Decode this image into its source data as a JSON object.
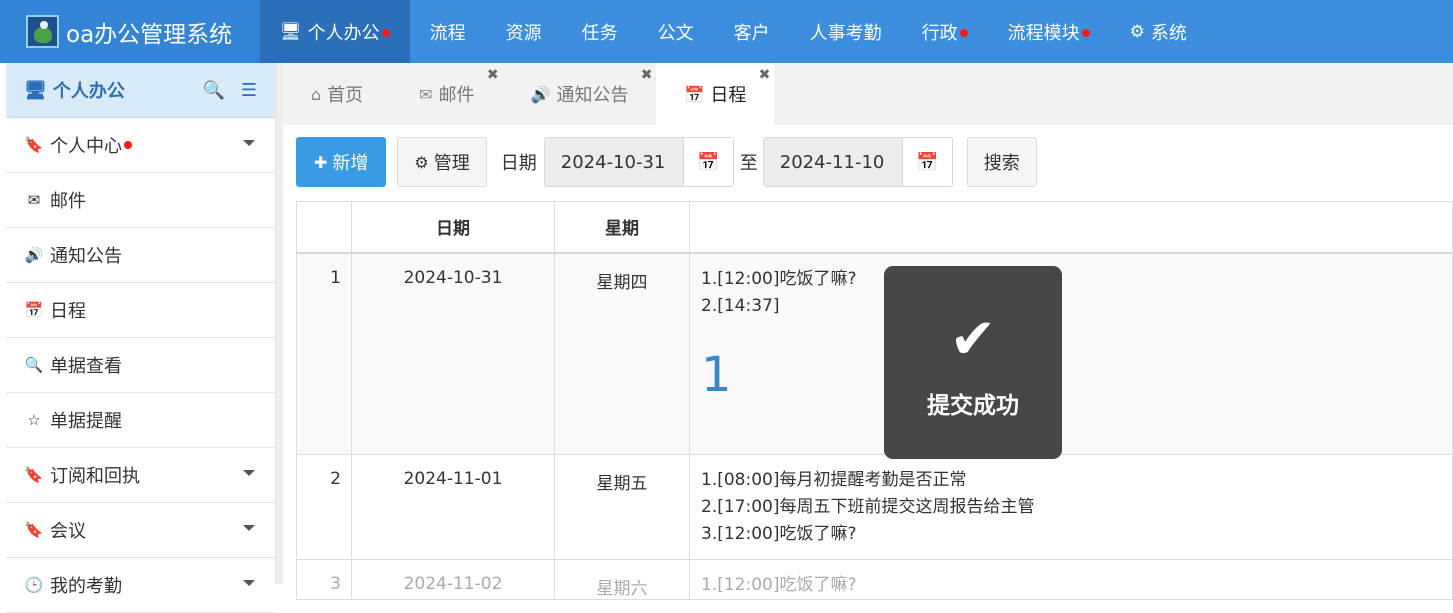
{
  "app": {
    "title": "oa办公管理系统"
  },
  "topnav": [
    {
      "label": "个人办公",
      "icon": "monitor-icon",
      "dot": true,
      "active": true
    },
    {
      "label": "流程"
    },
    {
      "label": "资源"
    },
    {
      "label": "任务"
    },
    {
      "label": "公文"
    },
    {
      "label": "客户"
    },
    {
      "label": "人事考勤"
    },
    {
      "label": "行政",
      "dot": true
    },
    {
      "label": "流程模块",
      "dot": true
    },
    {
      "label": "系统",
      "icon": "gear-icon"
    }
  ],
  "sidebar": {
    "header": "个人办公",
    "items": [
      {
        "label": "个人中心",
        "icon": "bookmark-icon",
        "dot": true,
        "caret": true
      },
      {
        "label": "邮件",
        "icon": "envelope-icon"
      },
      {
        "label": "通知公告",
        "icon": "speaker-icon"
      },
      {
        "label": "日程",
        "icon": "calendar-icon"
      },
      {
        "label": "单据查看",
        "icon": "search-icon"
      },
      {
        "label": "单据提醒",
        "icon": "star-icon"
      },
      {
        "label": "订阅和回执",
        "icon": "bookmark-icon",
        "caret": true
      },
      {
        "label": "会议",
        "icon": "bookmark-icon",
        "caret": true
      },
      {
        "label": "我的考勤",
        "icon": "clock-icon",
        "caret": true
      }
    ]
  },
  "tabs": [
    {
      "label": "首页",
      "icon": "home-icon",
      "closable": false
    },
    {
      "label": "邮件",
      "icon": "envelope-icon",
      "closable": true
    },
    {
      "label": "通知公告",
      "icon": "speaker-icon",
      "closable": true
    },
    {
      "label": "日程",
      "icon": "calendar-icon",
      "closable": true,
      "active": true
    }
  ],
  "toolbar": {
    "add_label": "新增",
    "manage_label": "管理",
    "date_label": "日期",
    "start_date": "2024-10-31",
    "to_label": "至",
    "end_date": "2024-11-10",
    "search_label": "搜索"
  },
  "table": {
    "headers": [
      "",
      "日期",
      "星期",
      ""
    ],
    "rows": [
      {
        "num": "1",
        "date": "2024-10-31",
        "week": "星期四",
        "items": [
          "1.[12:00]吃饭了嘛?",
          "2.[14:37]"
        ],
        "extra": "1"
      },
      {
        "num": "2",
        "date": "2024-11-01",
        "week": "星期五",
        "items": [
          "1.[08:00]每月初提醒考勤是否正常",
          "2.[17:00]每周五下班前提交这周报告给主管",
          "3.[12:00]吃饭了嘛?"
        ]
      },
      {
        "num": "3",
        "date": "2024-11-02",
        "week": "星期六",
        "items": [
          "1.[12:00]吃饭了嘛?"
        ]
      }
    ]
  },
  "toast": {
    "message": "提交成功"
  }
}
